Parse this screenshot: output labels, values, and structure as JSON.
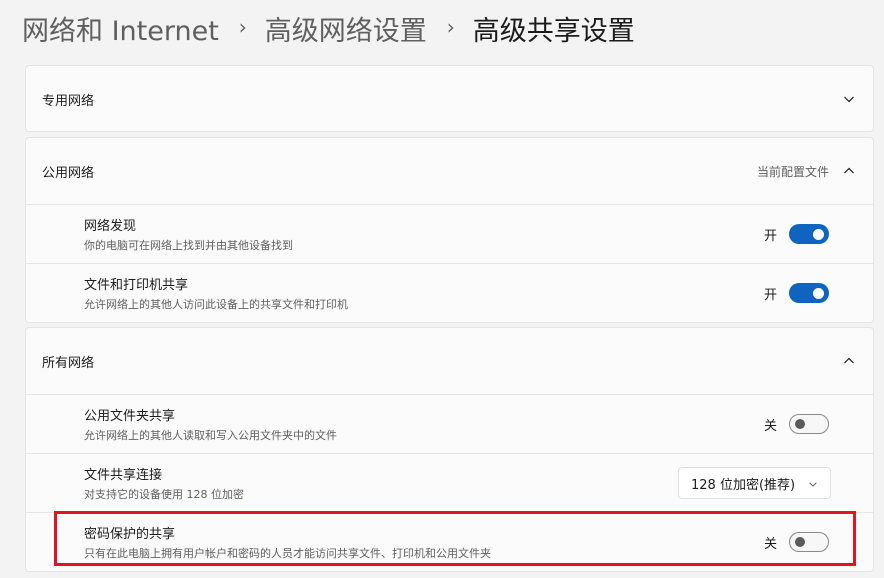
{
  "breadcrumb": {
    "items": [
      "网络和 Internet",
      "高级网络设置"
    ],
    "current": "高级共享设置",
    "separator": "›"
  },
  "private_network": {
    "title": "专用网络",
    "expanded": false,
    "chevron_icon": "chevron-down-icon"
  },
  "public_network": {
    "title": "公用网络",
    "note": "当前配置文件",
    "expanded": true,
    "chevron_icon": "chevron-up-icon",
    "rows": [
      {
        "title": "网络发现",
        "desc": "你的电脑可在网络上找到并由其他设备找到",
        "state": "开",
        "on": true
      },
      {
        "title": "文件和打印机共享",
        "desc": "允许网络上的其他人访问此设备上的共享文件和打印机",
        "state": "开",
        "on": true
      }
    ]
  },
  "all_networks": {
    "title": "所有网络",
    "expanded": true,
    "chevron_icon": "chevron-up-icon",
    "public_folder": {
      "title": "公用文件夹共享",
      "desc": "允许网络上的其他人读取和写入公用文件夹中的文件",
      "state": "关",
      "on": false
    },
    "file_sharing": {
      "title": "文件共享连接",
      "desc": "对支持它的设备使用 128 位加密",
      "selected": "128 位加密(推荐)"
    },
    "password": {
      "title": "密码保护的共享",
      "desc": "只有在此电脑上拥有用户帐户和密码的人员才能访问共享文件、打印机和公用文件夹",
      "state": "关",
      "on": false
    }
  },
  "colors": {
    "accent": "#0f64c0",
    "highlight": "#e81123",
    "background": "#f3f3f3",
    "card": "#fbfbfb"
  }
}
